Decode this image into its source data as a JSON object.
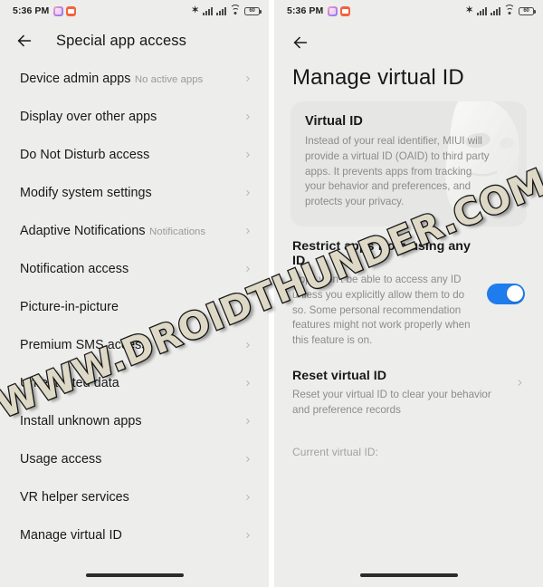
{
  "status_bar": {
    "time": "5:36 PM",
    "app_icons": [
      "gallery-icon",
      "messaging-icon"
    ],
    "bluetooth_icon": "bluetooth-icon",
    "signal_1_icon": "signal-bars-sim1-icon",
    "signal_2_icon": "signal-bars-sim2-icon",
    "wifi_icon": "wifi-icon",
    "battery_level": "60"
  },
  "left_screen": {
    "back_icon": "back-arrow-icon",
    "title": "Special app access",
    "items": [
      {
        "label": "Device admin apps",
        "sublabel": "No active apps",
        "chevron": true
      },
      {
        "label": "Display over other apps",
        "sublabel": "",
        "chevron": true
      },
      {
        "label": "Do Not Disturb access",
        "sublabel": "",
        "chevron": true
      },
      {
        "label": "Modify system settings",
        "sublabel": "",
        "chevron": true
      },
      {
        "label": "Adaptive Notifications",
        "sublabel": "Notifications",
        "chevron": true
      },
      {
        "label": "Notification access",
        "sublabel": "",
        "chevron": true
      },
      {
        "label": "Picture-in-picture",
        "sublabel": "",
        "chevron": true
      },
      {
        "label": "Premium SMS access",
        "sublabel": "",
        "chevron": true
      },
      {
        "label": "Unrestricted data",
        "sublabel": "",
        "chevron": true
      },
      {
        "label": "Install unknown apps",
        "sublabel": "",
        "chevron": true
      },
      {
        "label": "Usage access",
        "sublabel": "",
        "chevron": true
      },
      {
        "label": "VR helper services",
        "sublabel": "",
        "chevron": true
      },
      {
        "label": "Manage virtual ID",
        "sublabel": "",
        "chevron": true
      }
    ]
  },
  "right_screen": {
    "back_icon": "back-arrow-icon",
    "title": "Manage virtual ID",
    "info_card": {
      "title": "Virtual ID",
      "description": "Instead of your real identifier, MIUI will provide a virtual ID (OAID) to third party apps. It prevents apps from tracking your behavior and preferences, and protects your privacy.",
      "illustration": "mask-face-icon"
    },
    "restrict_section": {
      "title": "Restrict apps from using any ID",
      "description": "Apps won't be able to access any ID unless you explicitly allow them to do so. Some personal recommendation features might not work properly when this feature is on.",
      "toggle_on": true
    },
    "reset_section": {
      "title": "Reset virtual ID",
      "description": "Reset your virtual ID to clear your behavior and preference records",
      "chevron": true
    },
    "current_virtual_id_label": "Current virtual ID:"
  },
  "watermark": {
    "text": "WWW.DROIDTHUNDER.COM"
  },
  "colors": {
    "screen_bg": "#ededeb",
    "card_bg": "#e6e6e4",
    "toggle_on": "#1f7ced",
    "primary_text": "#18181a",
    "secondary_text": "#8c8c8c",
    "nav_pill": "#2b2b2b"
  }
}
